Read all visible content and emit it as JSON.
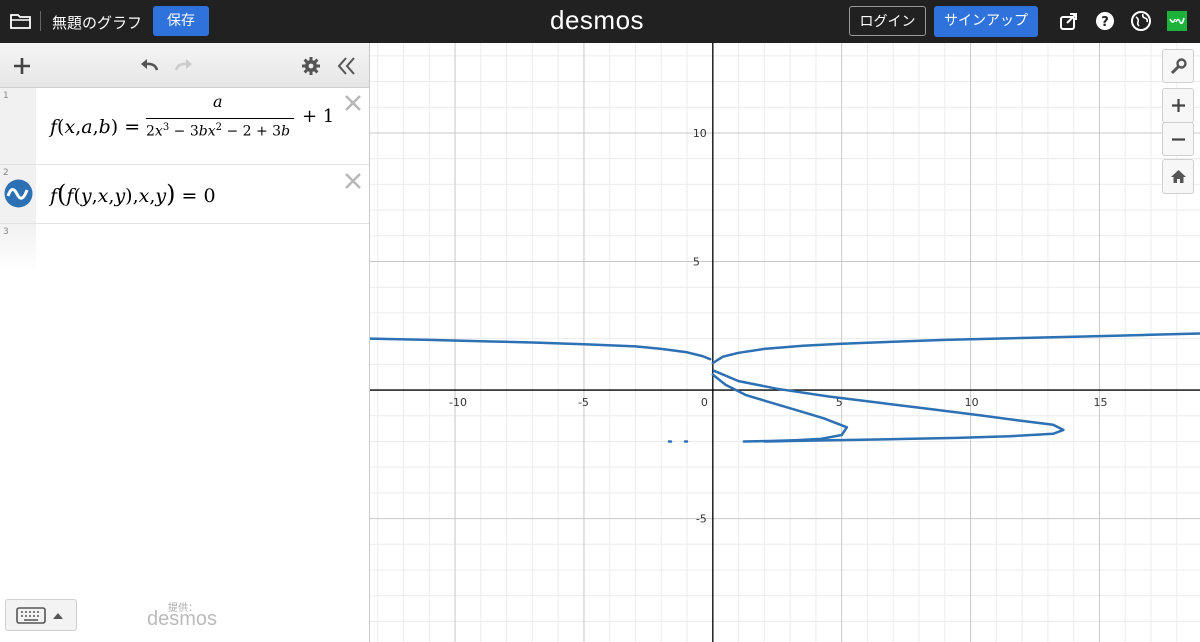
{
  "header": {
    "title": "無題のグラフ",
    "save_label": "保存",
    "brand": "desmos",
    "login_label": "ログイン",
    "signup_label": "サインアップ"
  },
  "expressions": [
    {
      "number": "1",
      "latex": "f(x,a,b) = a / (2x^3 - 3bx^2 - 2 + 3b) + 1"
    },
    {
      "number": "2",
      "latex": "f(f(y,x,y),x,y) = 0"
    },
    {
      "number": "3",
      "latex": ""
    }
  ],
  "footer": {
    "powered_label": "提供：",
    "powered_brand": "desmos"
  },
  "graph": {
    "curve_color": "#2d70b3",
    "x_tick_labels": [
      "-10",
      "-5",
      "0",
      "5",
      "10",
      "15"
    ],
    "y_tick_labels": [
      "10",
      "5",
      "-5"
    ]
  },
  "chart_data": {
    "type": "line",
    "xlim": [
      -13.3,
      18.9
    ],
    "ylim": [
      -9.8,
      13.5
    ],
    "x_ticks": [
      -10,
      -5,
      0,
      5,
      10,
      15
    ],
    "y_ticks": [
      10,
      5,
      -5
    ],
    "grid": true,
    "series": [
      {
        "color": "#2d70b3",
        "x": [
          -13.3,
          -11,
          -9,
          -7,
          -5,
          -3,
          -2,
          -1,
          -0.4,
          -0.1
        ],
        "y": [
          2.0,
          1.95,
          1.9,
          1.85,
          1.78,
          1.7,
          1.6,
          1.47,
          1.32,
          1.2
        ]
      },
      {
        "color": "#2d70b3",
        "x": [
          0.0,
          0.4,
          1.0,
          2.0,
          3.5,
          5.0,
          7.0,
          9.0,
          11.0,
          13.0,
          15.0,
          17.0,
          18.9
        ],
        "y": [
          1.05,
          1.3,
          1.45,
          1.6,
          1.72,
          1.8,
          1.88,
          1.95,
          2.0,
          2.05,
          2.1,
          2.15,
          2.2
        ]
      },
      {
        "color": "#2d70b3",
        "x": [
          0.0,
          0.5,
          1.3,
          2.3,
          3.3,
          4.3,
          5.2,
          5.0,
          4.2,
          3.2,
          2.2,
          1.2
        ],
        "y": [
          0.6,
          0.2,
          -0.2,
          -0.5,
          -0.8,
          -1.1,
          -1.45,
          -1.75,
          -1.9,
          -1.95,
          -1.98,
          -2.0
        ]
      },
      {
        "color": "#2d70b3",
        "x": [
          0.05,
          1.0,
          2.5,
          4.5,
          6.5,
          8.5,
          10.5,
          12.0,
          13.2,
          13.6,
          13.2,
          11.5,
          9.5,
          7.5,
          5.5,
          3.5,
          2.0
        ],
        "y": [
          0.75,
          0.35,
          0.05,
          -0.25,
          -0.5,
          -0.75,
          -1.0,
          -1.2,
          -1.35,
          -1.55,
          -1.7,
          -1.8,
          -1.86,
          -1.9,
          -1.94,
          -1.97,
          -2.0
        ]
      },
      {
        "color": "#2d70b3",
        "x": [
          -1.7,
          -1.0
        ],
        "y": [
          -2.0,
          -2.0
        ]
      }
    ]
  }
}
